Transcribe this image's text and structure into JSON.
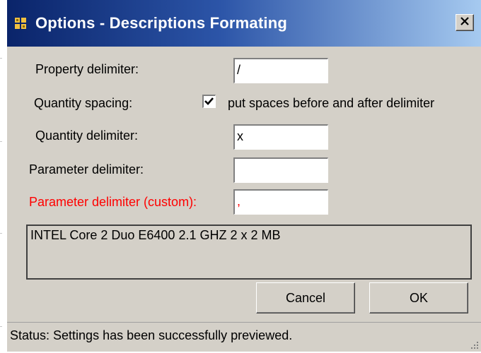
{
  "window": {
    "title": "Options - Descriptions Formating",
    "close_label": "X"
  },
  "form": {
    "property_delimiter": {
      "label": "Property delimiter:",
      "value": "/"
    },
    "quantity_spacing": {
      "label": "Quantity spacing:",
      "checked": true,
      "checkbox_label": "put spaces before and after delimiter"
    },
    "quantity_delimiter": {
      "label": "Quantity delimiter:",
      "value": "x"
    },
    "parameter_delimiter": {
      "label": "Parameter delimiter:",
      "value": ""
    },
    "parameter_delimiter_custom": {
      "label": "Parameter delimiter (custom):",
      "value": ","
    }
  },
  "preview": {
    "text": "INTEL Core 2 Duo E6400 2.1 GHZ 2 x 2 MB"
  },
  "buttons": {
    "cancel_label": "Cancel",
    "ok_label": "OK"
  },
  "statusbar": {
    "text": "Status:  Settings has been successfully previewed."
  },
  "colors": {
    "titlebar_start": "#0a246a",
    "titlebar_end": "#a6caf0",
    "window_face": "#d4d0c8",
    "custom_label": "#ff0000"
  },
  "icons": {
    "title_icon": "app-window-icon",
    "close_icon": "close-icon",
    "checkmark": "checkmark-icon",
    "grip": "resize-grip-icon"
  }
}
